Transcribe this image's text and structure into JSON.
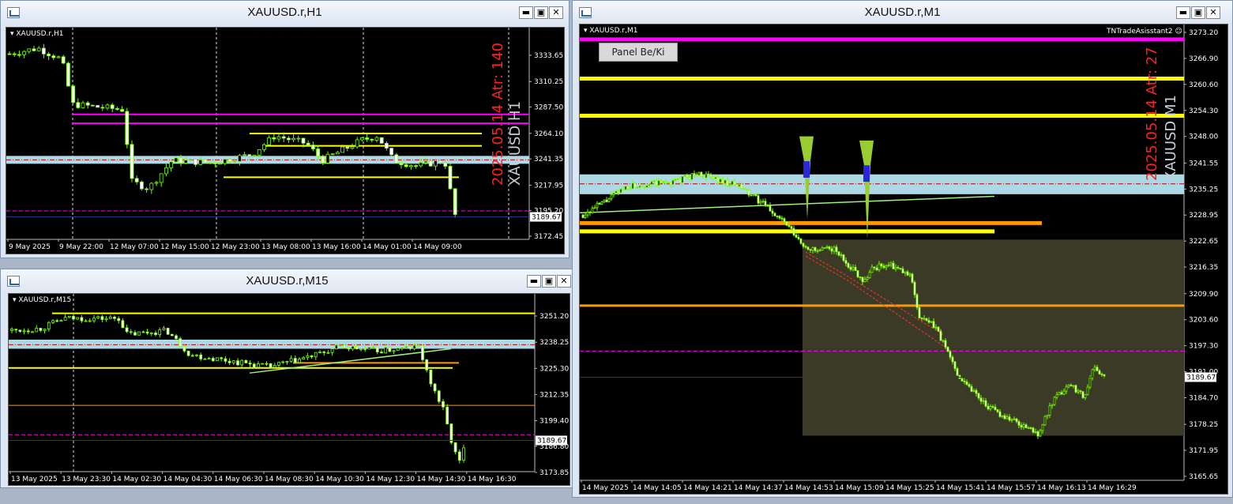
{
  "windows": [
    {
      "id": "h1",
      "title": "XAUUSD.r,H1",
      "symbol_label": "XAUUSD.r,H1",
      "prices": [
        "3333.65",
        "3310.25",
        "3287.50",
        "3264.10",
        "3241.35",
        "3217.95",
        "3195.20",
        "3172.45"
      ],
      "current_price": "3189.67",
      "times": [
        "9 May 2025",
        "9 May 22:00",
        "12 May 07:00",
        "12 May 15:00",
        "12 May 23:00",
        "13 May 08:00",
        "13 May 16:00",
        "14 May 01:00",
        "14 May 09:00"
      ],
      "vertical_text_atr": "2025.05.14 Atr: 140",
      "vertical_text_symbol": "XAUUSD H1"
    },
    {
      "id": "m15",
      "title": "XAUUSD.r,M15",
      "symbol_label": "XAUUSD.r,M15",
      "prices": [
        "3251.20",
        "3238.25",
        "3225.30",
        "3212.35",
        "3199.40",
        "3186.80",
        "3173.85"
      ],
      "current_price": "3189.67",
      "times": [
        "13 May 2025",
        "13 May 23:30",
        "14 May 02:30",
        "14 May 04:30",
        "14 May 06:30",
        "14 May 08:30",
        "14 May 10:30",
        "14 May 12:30",
        "14 May 14:30",
        "14 May 16:30"
      ]
    },
    {
      "id": "m1",
      "title": "XAUUSD.r,M1",
      "symbol_label": "XAUUSD.r,M1",
      "prices": [
        "3273.20",
        "3266.90",
        "3260.60",
        "3254.30",
        "3248.00",
        "3241.55",
        "3235.25",
        "3228.95",
        "3222.65",
        "3216.35",
        "3209.90",
        "3203.60",
        "3197.30",
        "3191.00",
        "3184.70",
        "3178.25",
        "3171.95",
        "3165.65"
      ],
      "current_price": "3189.67",
      "times": [
        "14 May 2025",
        "14 May 14:05",
        "14 May 14:21",
        "14 May 14:37",
        "14 May 14:53",
        "14 May 15:09",
        "14 May 15:25",
        "14 May 15:41",
        "14 May 15:57",
        "14 May 16:13",
        "14 May 16:29"
      ],
      "vertical_text_atr": "2025.05.14 Atr: 27",
      "vertical_text_symbol": "XAUUSD M1",
      "panel_button": "Panel Be/Ki",
      "indicator_label": "TNTradeAsisstant2"
    }
  ],
  "controls": {
    "minimize": "▬",
    "restore": "▣",
    "close": "✕"
  },
  "colors": {
    "bull": "#7cfc00",
    "bear": "#ffffff",
    "magenta": "#ff00ff",
    "yellow": "#ffff00",
    "orange": "#ff9900",
    "zone": "#add8e6",
    "box": "#3a3a26",
    "red_text": "#ff2020",
    "gray_text": "#c8d0d8"
  }
}
